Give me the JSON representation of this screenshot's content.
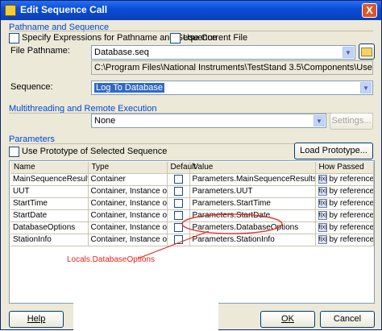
{
  "window": {
    "title": "Edit Sequence Call",
    "close_glyph": "X"
  },
  "pathname_section": {
    "header": "Pathname and Sequence",
    "specify_expressions_label": "Specify Expressions for Pathname and Sequence",
    "use_current_file_label": "Use Current File",
    "file_pathname_label": "File Pathname:",
    "file_pathname_value": "Database.seq",
    "full_path": "C:\\Program Files\\National Instruments\\TestStand 3.5\\Components\\User\\Models\\TestStandMod",
    "sequence_label": "Sequence:",
    "sequence_value": "Log To Database"
  },
  "multithreading_section": {
    "header": "Multithreading and Remote Execution",
    "value": "None",
    "settings_button": "Settings..."
  },
  "parameters_section": {
    "header": "Parameters",
    "use_prototype_label": "Use Prototype of Selected Sequence",
    "load_prototype_button": "Load Prototype...",
    "columns": {
      "name": "Name",
      "type": "Type",
      "default": "Default",
      "value": "Value",
      "how_passed": "How Passed"
    },
    "rows": [
      {
        "name": "MainSequenceResults",
        "type": "Container",
        "value": "Parameters.MainSequenceResults",
        "how": "by reference"
      },
      {
        "name": "UUT",
        "type": "Container, Instance of Ty",
        "value": "Parameters.UUT",
        "how": "by reference"
      },
      {
        "name": "StartTime",
        "type": "Container, Instance of Ty",
        "value": "Parameters.StartTime",
        "how": "by reference"
      },
      {
        "name": "StartDate",
        "type": "Container, Instance of Ty",
        "value": "Parameters.StartDate",
        "how": "by reference"
      },
      {
        "name": "DatabaseOptions",
        "type": "Container, Instance of Ty",
        "value": "Parameters.DatabaseOptions",
        "how": "by reference"
      },
      {
        "name": "StationInfo",
        "type": "Container, Instance of Ty",
        "value": "Parameters.StationInfo",
        "how": "by reference"
      }
    ],
    "expression_button": "f(x)"
  },
  "annotation": {
    "text": "Locals.DatabaseOptions",
    "color": "#e8201a"
  },
  "footer": {
    "help_button": "Help",
    "ok_button": "OK",
    "cancel_button": "Cancel"
  },
  "colors": {
    "title_bar": "#0a4ed8",
    "section_header": "#0046d5",
    "selection": "#316ac5"
  },
  "icons": {
    "app_icon": "teststand-icon",
    "browse_icon": "folder-open-icon",
    "dropdown_icon": "chevron-down-icon"
  }
}
